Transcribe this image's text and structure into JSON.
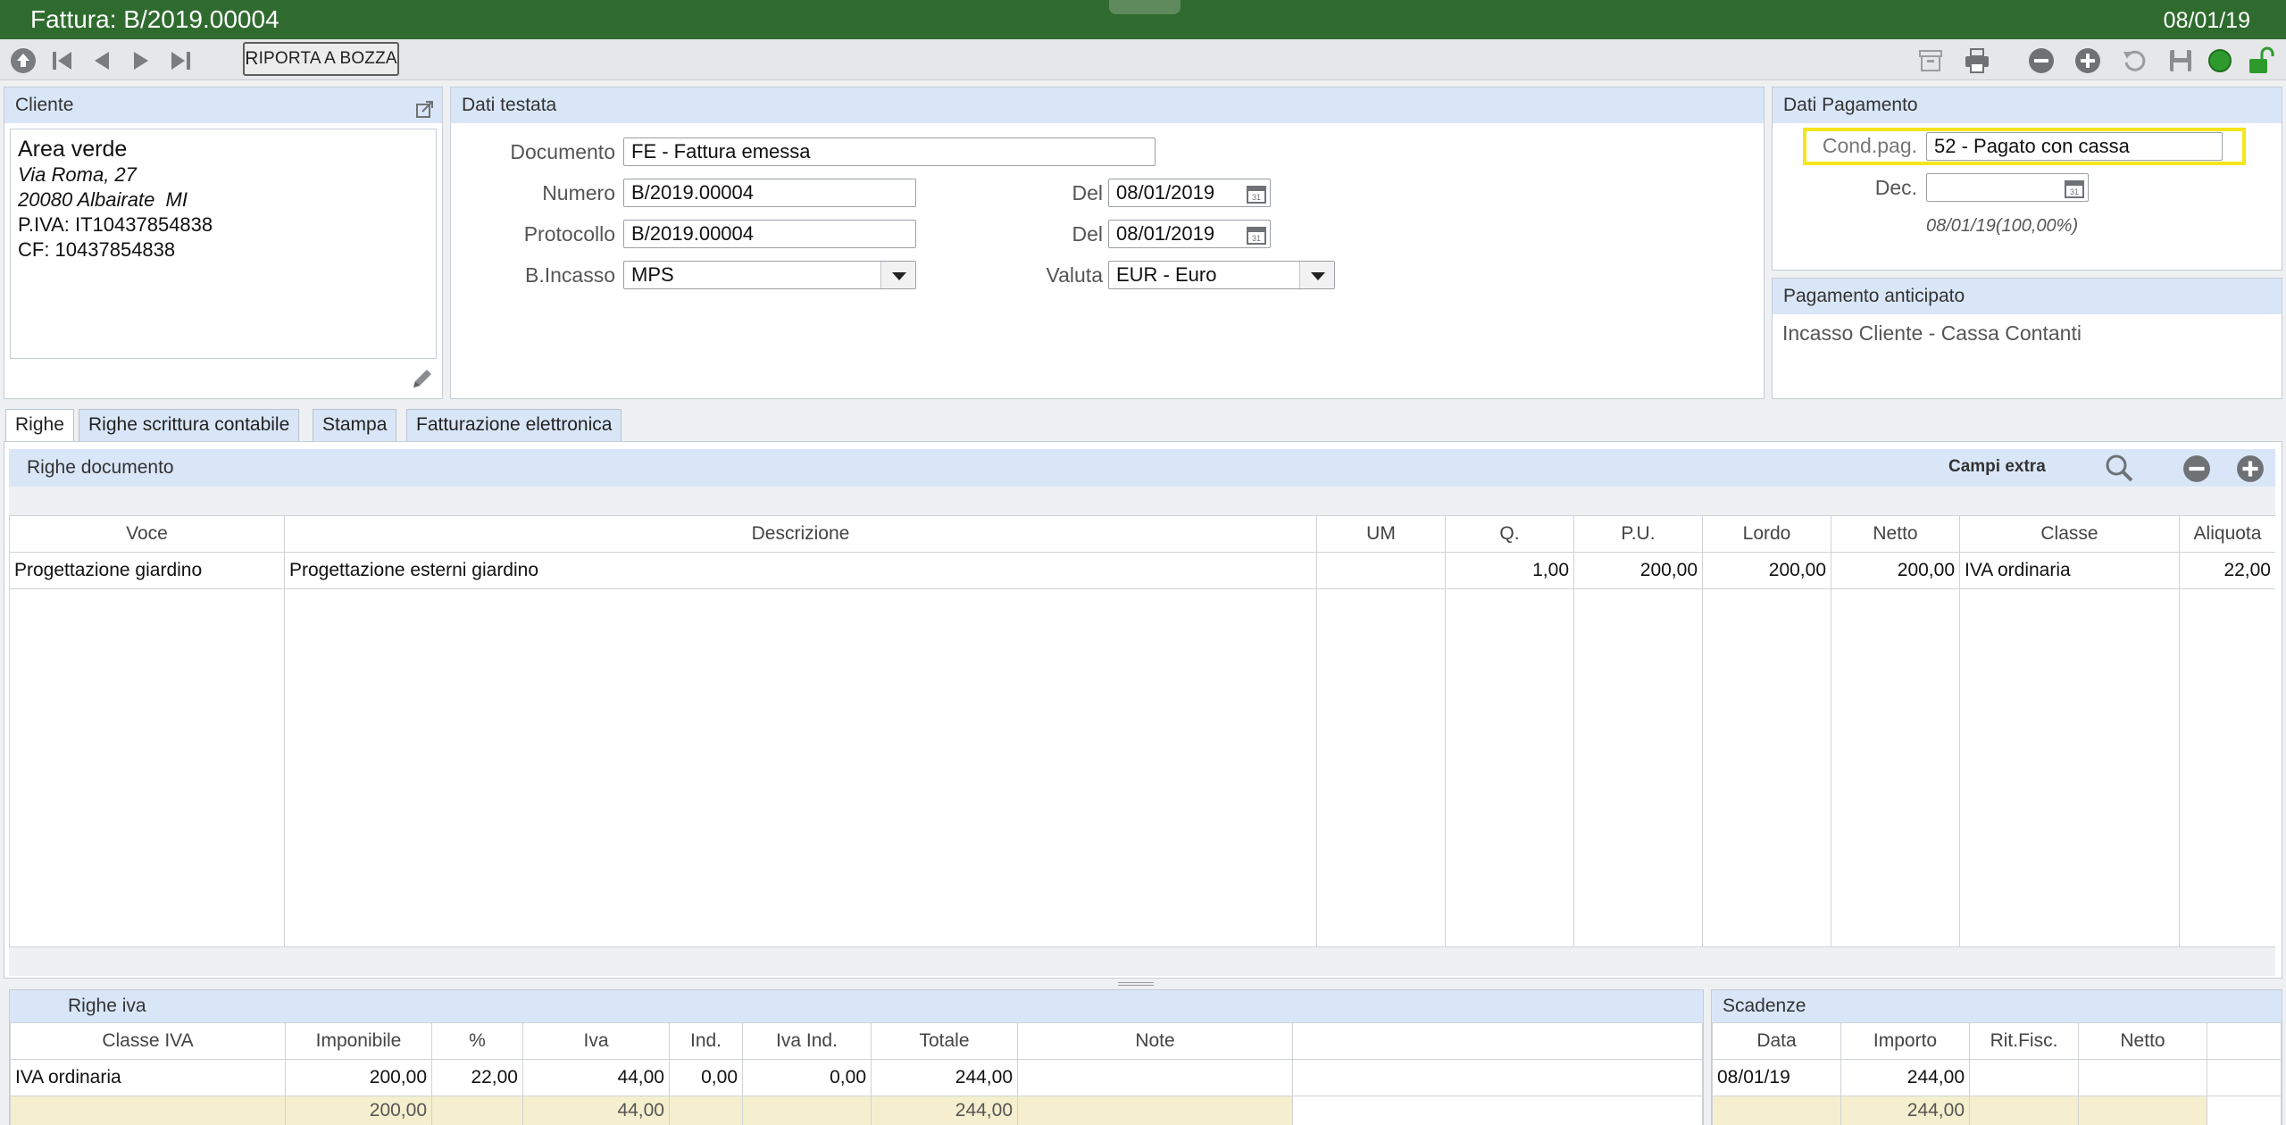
{
  "window": {
    "title": "Fattura: B/2019.00004",
    "date": "08/01/19"
  },
  "toolbar": {
    "draft_label_first": "R",
    "draft_label_rest": "IPORTA A BOZZA"
  },
  "cliente": {
    "header": "Cliente",
    "name": "Area verde",
    "address1": "Via Roma, 27",
    "address2": "20080 Albairate  MI",
    "piva": "P.IVA: IT10437854838",
    "cf": "CF: 10437854838"
  },
  "testata": {
    "header": "Dati testata",
    "documento_label": "Documento",
    "documento_value": "FE - Fattura emessa",
    "numero_label": "Numero",
    "numero_value": "B/2019.00004",
    "del1_label": "Del",
    "del1_value": "08/01/2019",
    "protocollo_label": "Protocollo",
    "protocollo_value": "B/2019.00004",
    "del2_label": "Del",
    "del2_value": "08/01/2019",
    "incasso_label": "B.Incasso",
    "incasso_value": "MPS",
    "valuta_label": "Valuta",
    "valuta_value": "EUR - Euro"
  },
  "pagamento": {
    "header": "Dati Pagamento",
    "cond_label": "Cond.pag.",
    "cond_value": "52 - Pagato con cassa",
    "dec_label": "Dec.",
    "dec_value": "",
    "schedule": "08/01/19(100,00%)"
  },
  "anticipato": {
    "header": "Pagamento anticipato",
    "value": "Incasso Cliente - Cassa Contanti"
  },
  "tabs": [
    "Righe",
    "Righe scrittura contabile",
    "Stampa",
    "Fatturazione elettronica"
  ],
  "righe": {
    "header": "Righe documento",
    "extra": "Campi extra",
    "columns": [
      "Voce",
      "Descrizione",
      "UM",
      "Q.",
      "P.U.",
      "Lordo",
      "Netto",
      "Classe",
      "Aliquota"
    ],
    "rows": [
      [
        "Progettazione giardino",
        "Progettazione esterni giardino",
        "",
        "1,00",
        "200,00",
        "200,00",
        "200,00",
        "IVA ordinaria",
        "22,00"
      ]
    ]
  },
  "iva": {
    "header": "Righe iva",
    "columns": [
      "Classe IVA",
      "Imponibile",
      "%",
      "Iva",
      "Ind.",
      "Iva Ind.",
      "Totale",
      "Note"
    ],
    "rows": [
      [
        "IVA ordinaria",
        "200,00",
        "22,00",
        "44,00",
        "0,00",
        "0,00",
        "244,00",
        ""
      ]
    ],
    "totals": [
      "",
      "200,00",
      "",
      "44,00",
      "",
      "",
      "244,00",
      ""
    ]
  },
  "scadenze": {
    "header": "Scadenze",
    "columns": [
      "Data",
      "Importo",
      "Rit.Fisc.",
      "Netto"
    ],
    "rows": [
      [
        "08/01/19",
        "244,00",
        "",
        ""
      ]
    ],
    "totals": [
      "",
      "244,00",
      "",
      ""
    ]
  }
}
